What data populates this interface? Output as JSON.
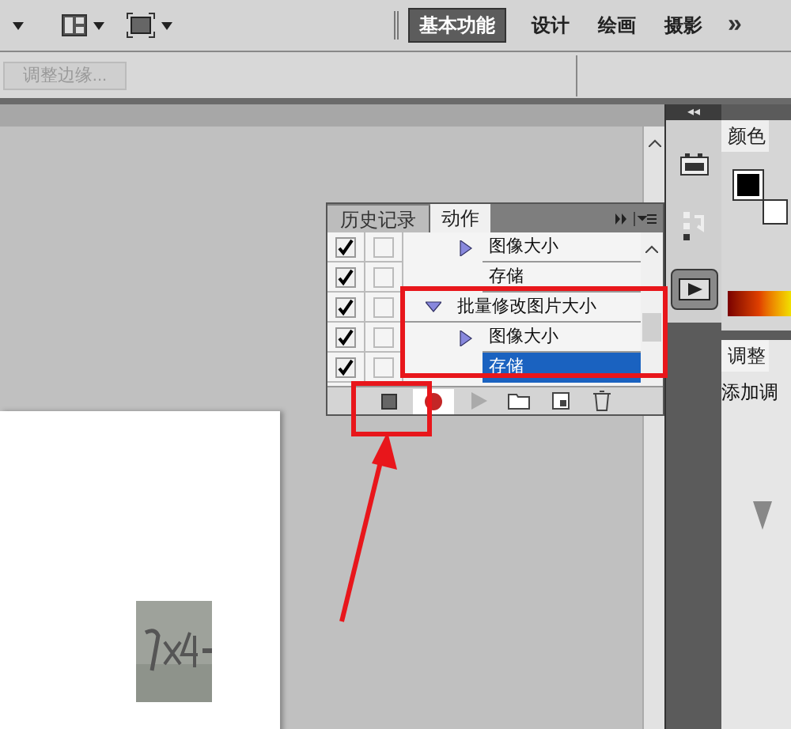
{
  "workspaces": [
    {
      "label": "基本功能",
      "selected": true
    },
    {
      "label": "设计",
      "selected": false
    },
    {
      "label": "绘画",
      "selected": false
    },
    {
      "label": "摄影",
      "selected": false
    }
  ],
  "more_workspaces": "»",
  "options_bar": {
    "refine_edge": {
      "label": "调整边缘...",
      "disabled": true
    }
  },
  "dock": {
    "collapse": "◂◂",
    "buttons": [
      {
        "kind": "plugin",
        "selected": false
      },
      {
        "kind": "history",
        "selected": false
      },
      {
        "kind": "actions",
        "selected": true
      }
    ]
  },
  "color_panel": {
    "tab": "颜色"
  },
  "adjustments_panel": {
    "tab": "调整",
    "label": "添加调"
  },
  "actions_panel": {
    "tabs": [
      {
        "label": "历史记录",
        "selected": false
      },
      {
        "label": "动作",
        "selected": true
      }
    ],
    "rows": [
      {
        "label": "图像大小",
        "kind": "command",
        "checked": true,
        "dialog": false,
        "expanded": false,
        "selected": false
      },
      {
        "label": "存储",
        "kind": "command",
        "checked": true,
        "dialog": false,
        "selected": false
      },
      {
        "label": "批量修改图片大小",
        "kind": "action",
        "checked": true,
        "dialog": false,
        "expanded": true,
        "selected": false,
        "children": [
          {
            "label": "图像大小",
            "kind": "command",
            "checked": true,
            "dialog": false,
            "expanded": false,
            "selected": false
          },
          {
            "label": "存储",
            "kind": "command",
            "checked": true,
            "dialog": false,
            "selected": true
          }
        ]
      }
    ],
    "toolbar": [
      {
        "kind": "stop",
        "disabled": false
      },
      {
        "kind": "record",
        "disabled": false
      },
      {
        "kind": "play",
        "disabled": true
      },
      {
        "kind": "folder",
        "disabled": false
      },
      {
        "kind": "new",
        "disabled": false
      },
      {
        "kind": "trash",
        "disabled": false
      }
    ]
  }
}
